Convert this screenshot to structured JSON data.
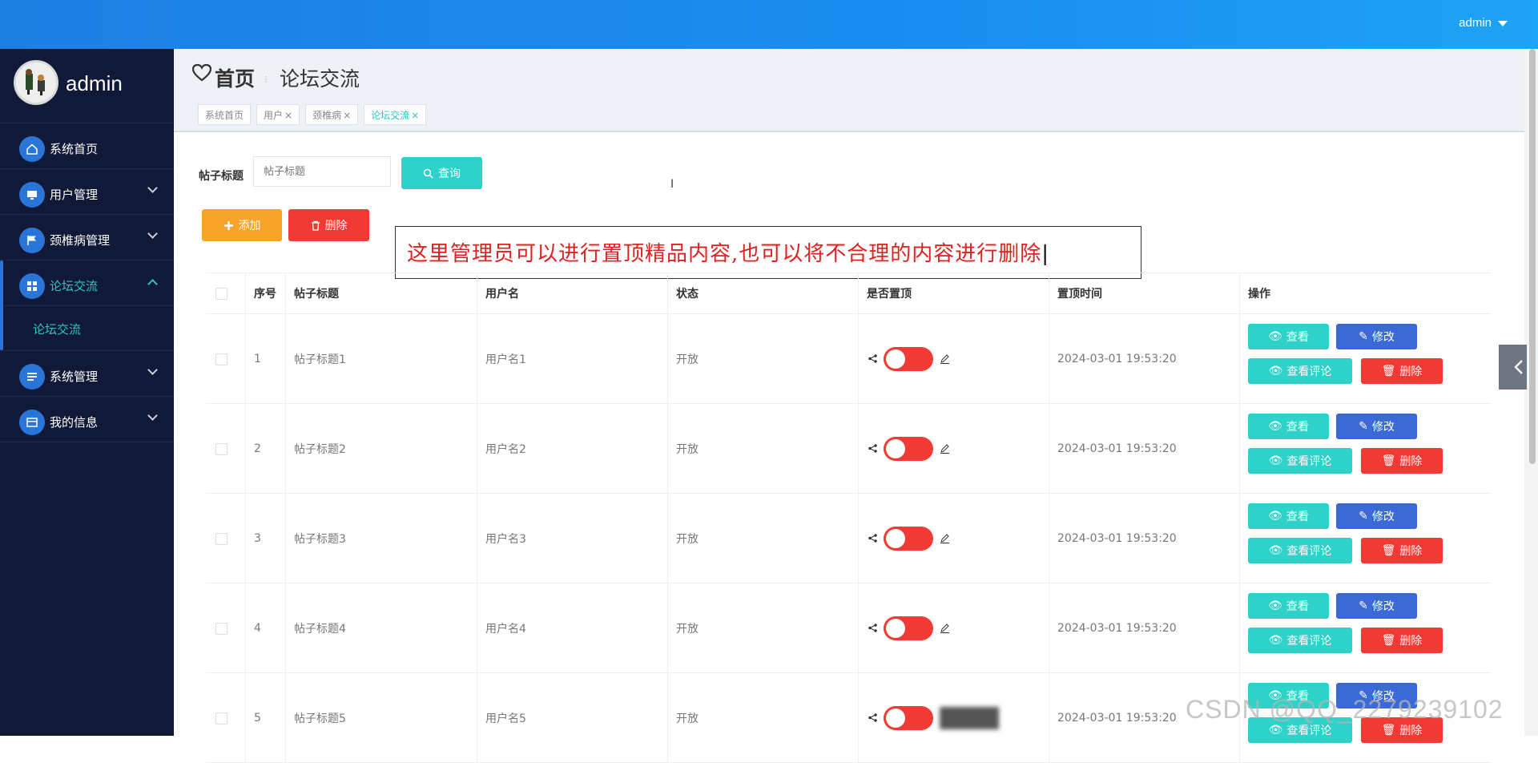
{
  "header": {
    "user_label": "admin"
  },
  "sidebar": {
    "brand_name": "admin",
    "items": [
      {
        "label": "系统首页",
        "icon": "home-icon"
      },
      {
        "label": "用户管理",
        "icon": "monitor-icon"
      },
      {
        "label": "颈椎病管理",
        "icon": "flag-icon"
      },
      {
        "label": "论坛交流",
        "icon": "grid-icon",
        "active": true,
        "sub": "论坛交流"
      },
      {
        "label": "系统管理",
        "icon": "list-icon"
      },
      {
        "label": "我的信息",
        "icon": "card-icon"
      }
    ]
  },
  "page": {
    "crumb_home": "首页",
    "crumb_current": "论坛交流",
    "tags": [
      "系统首页",
      "用户",
      "颈椎病",
      "论坛交流"
    ],
    "tag_close": "×"
  },
  "search": {
    "label": "帖子标题",
    "placeholder": "帖子标题",
    "query_button": "查询"
  },
  "actions": {
    "add": "添加",
    "delete": "删除"
  },
  "note": "这里管理员可以进行置顶精品内容,也可以将不合理的内容进行删除",
  "table": {
    "columns": [
      "序号",
      "帖子标题",
      "用户名",
      "状态",
      "是否置顶",
      "置顶时间",
      "操作"
    ],
    "rows": [
      {
        "no": "1",
        "title": "帖子标题1",
        "user": "用户名1",
        "status": "开放",
        "time": "2024-03-01 19:53:20"
      },
      {
        "no": "2",
        "title": "帖子标题2",
        "user": "用户名2",
        "status": "开放",
        "time": "2024-03-01 19:53:20"
      },
      {
        "no": "3",
        "title": "帖子标题3",
        "user": "用户名3",
        "status": "开放",
        "time": "2024-03-01 19:53:20"
      },
      {
        "no": "4",
        "title": "帖子标题4",
        "user": "用户名4",
        "status": "开放",
        "time": "2024-03-01 19:53:20"
      },
      {
        "no": "5",
        "title": "帖子标题5",
        "user": "用户名5",
        "status": "开放",
        "time": "2024-03-01 19:53:20"
      }
    ],
    "ops": {
      "view": "查看",
      "edit": "修改",
      "comments": "查看评论",
      "delete": "删除"
    }
  },
  "watermark": "CSDN @QQ_2279239102",
  "colors": {
    "accent": "#2ec4c0",
    "primary": "#1e7fe3",
    "danger": "#f23a34",
    "warning": "#f8a32a",
    "sidebar": "#101a38"
  }
}
